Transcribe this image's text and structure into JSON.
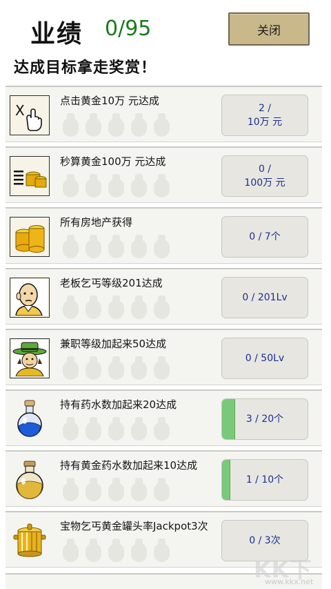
{
  "header": {
    "title": "业绩",
    "progress": "0/95",
    "close_label": "关闭",
    "subtitle": "达成目标拿走奖赏！"
  },
  "colors": {
    "close_button": "#c9b88a",
    "progress_text": "#1a7a1a",
    "status_text": "#1a2f8f",
    "progress_fill": "#7ac879"
  },
  "achievements": [
    {
      "icon": "tap-hand-icon",
      "text": "点击黄金10万 元达成",
      "status_line1": "2 /",
      "status_line2": "10万 元",
      "progress_fraction": 0.0
    },
    {
      "icon": "gold-stack-icon",
      "text": "秒算黄金100万 元达成",
      "status_line1": "0 /",
      "status_line2": "100万 元",
      "progress_fraction": 0.0
    },
    {
      "icon": "gold-coins-icon",
      "text": "所有房地产获得",
      "status_line1": "0 / 7个",
      "status_line2": "",
      "progress_fraction": 0.0
    },
    {
      "icon": "beggar-boss-icon",
      "text": "老板乞丐等级201达成",
      "status_line1": "0 / 201Lv",
      "status_line2": "",
      "progress_fraction": 0.0
    },
    {
      "icon": "hat-worker-icon",
      "text": "兼职等级加起来50达成",
      "status_line1": "0 / 50Lv",
      "status_line2": "",
      "progress_fraction": 0.0
    },
    {
      "icon": "blue-potion-icon",
      "text": "持有药水数加起来20达成",
      "status_line1": "3 / 20个",
      "status_line2": "",
      "progress_fraction": 0.15
    },
    {
      "icon": "gold-potion-icon",
      "text": "持有黄金药水数加起来10达成",
      "status_line1": "1 / 10个",
      "status_line2": "",
      "progress_fraction": 0.1
    },
    {
      "icon": "gold-pot-icon",
      "text": "宝物乞丐黄金罐头率Jackpot3次",
      "status_line1": "0 / 3次",
      "status_line2": "",
      "progress_fraction": 0.0
    }
  ],
  "watermark": {
    "logo": "KK下载",
    "url": "www.kkx.net"
  }
}
